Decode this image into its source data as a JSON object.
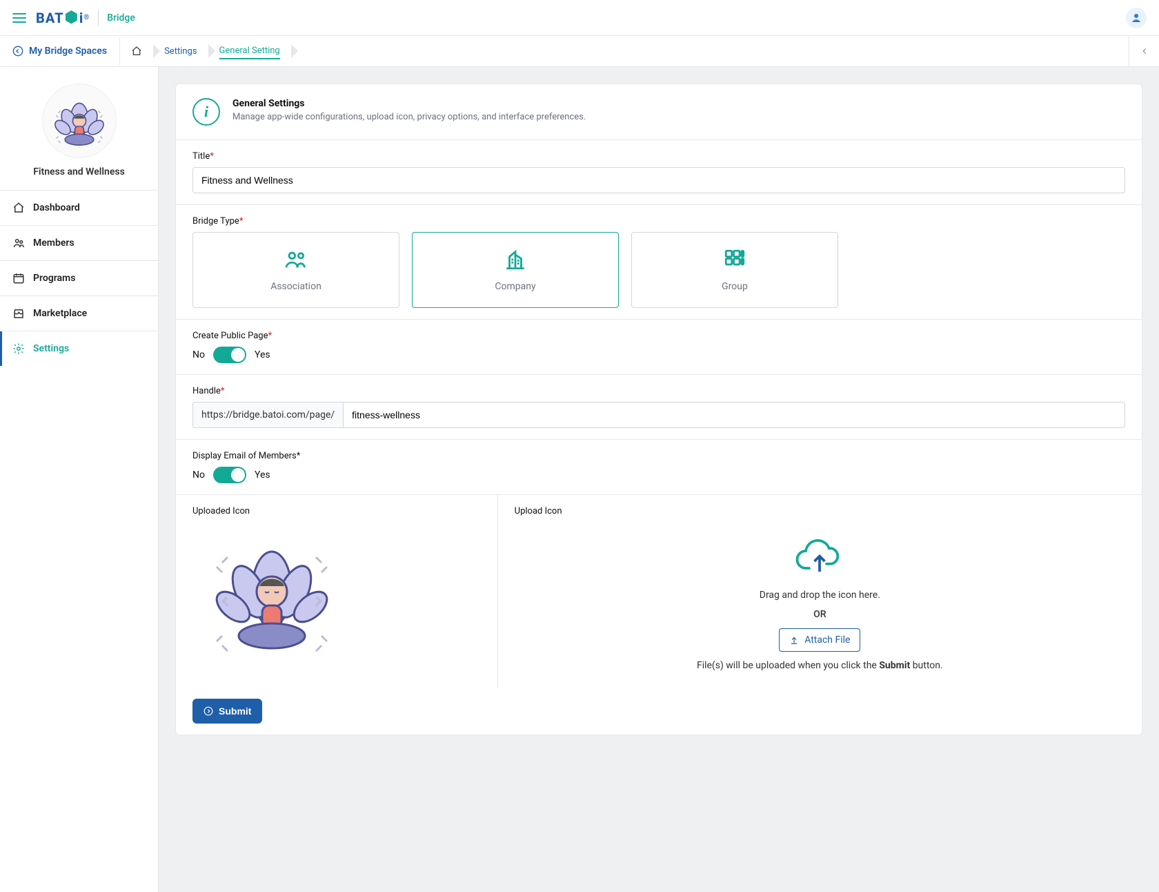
{
  "app": {
    "brand": "BAT",
    "brand_accent_letter": "i",
    "app_name": "Bridge"
  },
  "breadcrumbBar": {
    "back_label": "My Bridge Spaces",
    "crumbs": [
      {
        "label": "Settings",
        "active": false
      },
      {
        "label": "General Setting",
        "active": true
      }
    ]
  },
  "sidebar": {
    "space_name": "Fitness and Wellness",
    "items": [
      {
        "label": "Dashboard"
      },
      {
        "label": "Members"
      },
      {
        "label": "Programs"
      },
      {
        "label": "Marketplace"
      },
      {
        "label": "Settings",
        "active": true
      }
    ]
  },
  "panel": {
    "title": "General Settings",
    "subtitle": "Manage app-wide configurations, upload icon, privacy options, and interface preferences."
  },
  "form": {
    "title_label": "Title",
    "title_value": "Fitness and Wellness",
    "bridge_type_label": "Bridge Type",
    "types": [
      {
        "name": "Association"
      },
      {
        "name": "Company",
        "selected": true
      },
      {
        "name": "Group"
      }
    ],
    "public_page_label": "Create Public Page",
    "toggle_no": "No",
    "toggle_yes": "Yes",
    "public_page_on": true,
    "handle_label": "Handle",
    "handle_prefix": "https://bridge.batoi.com/page/",
    "handle_value": "fitness-wellness",
    "display_email_label": "Display Email of Members",
    "display_email_on": true,
    "uploaded_icon_label": "Uploaded Icon",
    "upload_icon_label": "Upload Icon",
    "drag_text": "Drag and drop the icon here.",
    "or_text": "OR",
    "attach_label": "Attach File",
    "upload_hint_prefix": "File(s) will be uploaded when you click the ",
    "upload_hint_strong": "Submit",
    "upload_hint_suffix": " button.",
    "submit_label": "Submit"
  }
}
